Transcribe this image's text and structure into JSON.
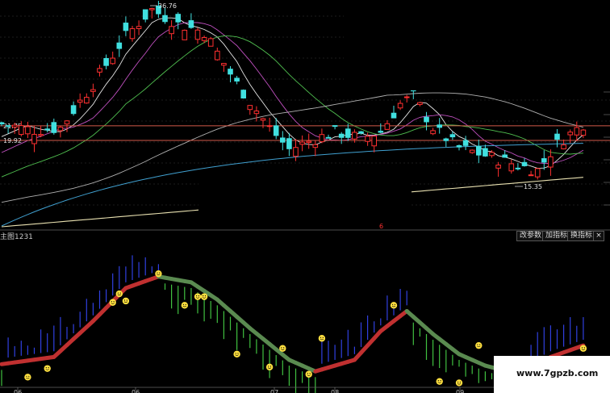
{
  "chart_data": {
    "type": "candlestick",
    "price_labels": {
      "high_marker": "36.76",
      "low_marker": "15.35",
      "level_a": "21.75",
      "level_b": "19.92",
      "tick_y": "6"
    },
    "indicator_title": "主图1231",
    "buttons": [
      "改参数",
      "加指标",
      "换指标"
    ],
    "x_tick_labels": [
      "06",
      "06",
      "07",
      "08",
      "09"
    ],
    "colors": {
      "up": "#ff3030",
      "down": "#40e0e0",
      "level_line": "#d25a4a",
      "ma5": "#e6e6e6",
      "ma10": "#c050c0",
      "ma20": "#50c050",
      "ma60": "#b0b0b0",
      "ma120": "#40a0d0",
      "ma250": "#e8e0b0",
      "ribbon_up": "#c03030",
      "ribbon_down": "#5a8a50",
      "smiley": "#ffe040"
    },
    "icons": [
      "smiley-icon"
    ],
    "watermark": "www.7gpzb.com"
  }
}
